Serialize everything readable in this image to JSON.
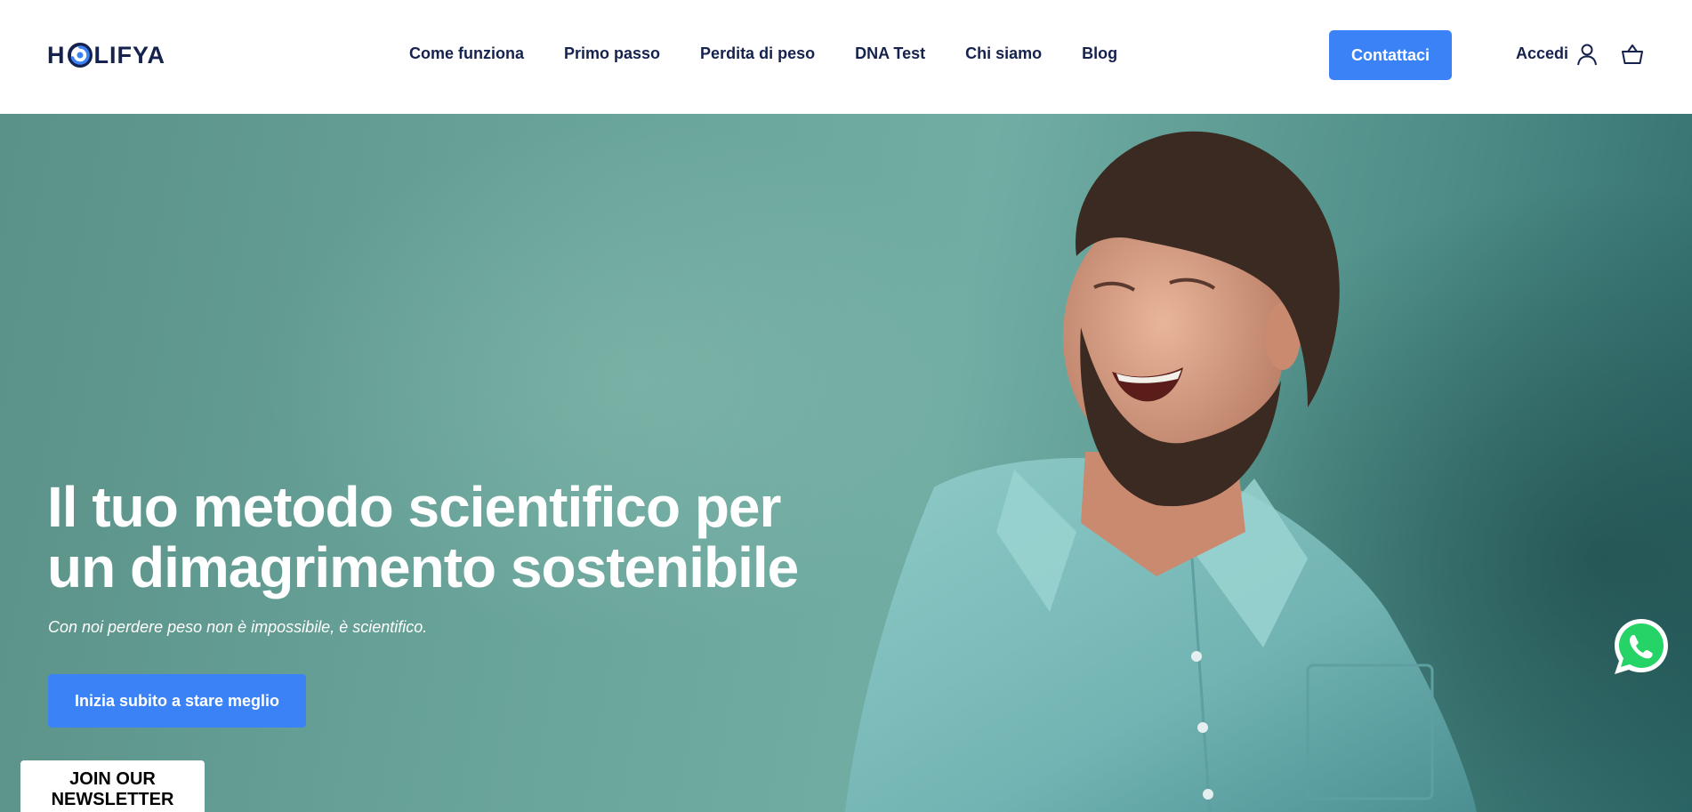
{
  "brand": {
    "name": "HOLIFYA",
    "prefix": "H",
    "suffix": "LIFYA",
    "accent": "#3b82f6",
    "navy": "#15224d"
  },
  "nav": {
    "items": [
      {
        "label": "Come funziona"
      },
      {
        "label": "Primo passo"
      },
      {
        "label": "Perdita di peso"
      },
      {
        "label": "DNA Test"
      },
      {
        "label": "Chi siamo"
      },
      {
        "label": "Blog"
      }
    ]
  },
  "header": {
    "cta_label": "Contattaci",
    "login_label": "Accedi",
    "user_icon": "user-icon",
    "cart_icon": "cart-icon"
  },
  "hero": {
    "title": "Il tuo metodo scientifico per un dimagrimento sostenibile",
    "subtitle": "Con noi perdere peso non è impossibile, è scientifico.",
    "button_label": "Inizia subito a stare meglio",
    "background_color": "#6aa59b"
  },
  "newsletter": {
    "line1": "JOIN OUR",
    "line2": "NEWSLETTER"
  },
  "floating": {
    "whatsapp_icon": "whatsapp-icon",
    "whatsapp_color": "#25d366"
  }
}
